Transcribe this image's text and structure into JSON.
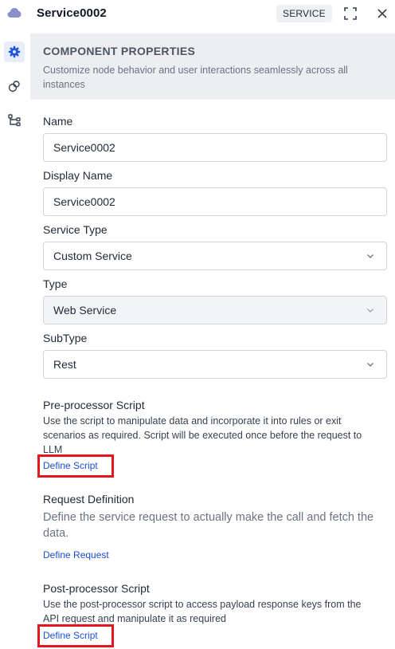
{
  "header": {
    "title": "Service0002",
    "badge": "SERVICE",
    "icons": {
      "app": "cloud-icon",
      "expand": "expand-icon",
      "close": "close-icon"
    }
  },
  "rail": {
    "items": [
      {
        "icon": "gear-icon",
        "active": true
      },
      {
        "icon": "link-circles-icon",
        "active": false
      },
      {
        "icon": "flow-tree-icon",
        "active": false
      }
    ]
  },
  "banner": {
    "title": "COMPONENT PROPERTIES",
    "description": "Customize node behavior and user interactions seamlessly across all instances"
  },
  "form": {
    "name": {
      "label": "Name",
      "value": "Service0002"
    },
    "display_name": {
      "label": "Display Name",
      "value": "Service0002"
    },
    "service_type": {
      "label": "Service Type",
      "value": "Custom Service"
    },
    "type": {
      "label": "Type",
      "value": "Web Service",
      "disabled": true
    },
    "subtype": {
      "label": "SubType",
      "value": "Rest"
    }
  },
  "sections": {
    "pre": {
      "title": "Pre-processor Script",
      "description": "Use the script to manipulate data and incorporate it into rules or exit scenarios as required. Script will be executed once before the request to LLM",
      "link": "Define Script"
    },
    "request": {
      "title": "Request Definition",
      "description": "Define the service request to actually make the call and fetch the data.",
      "link": "Define Request"
    },
    "post": {
      "title": "Post-processor Script",
      "description": "Use the post-processor script to access payload response keys from the API request and manipulate it as required",
      "link": "Define Script"
    }
  },
  "colors": {
    "accent": "#1d4ed8",
    "highlight": "#e5161e",
    "banner_bg": "#eceef2",
    "cloud": "#8b90c8"
  }
}
